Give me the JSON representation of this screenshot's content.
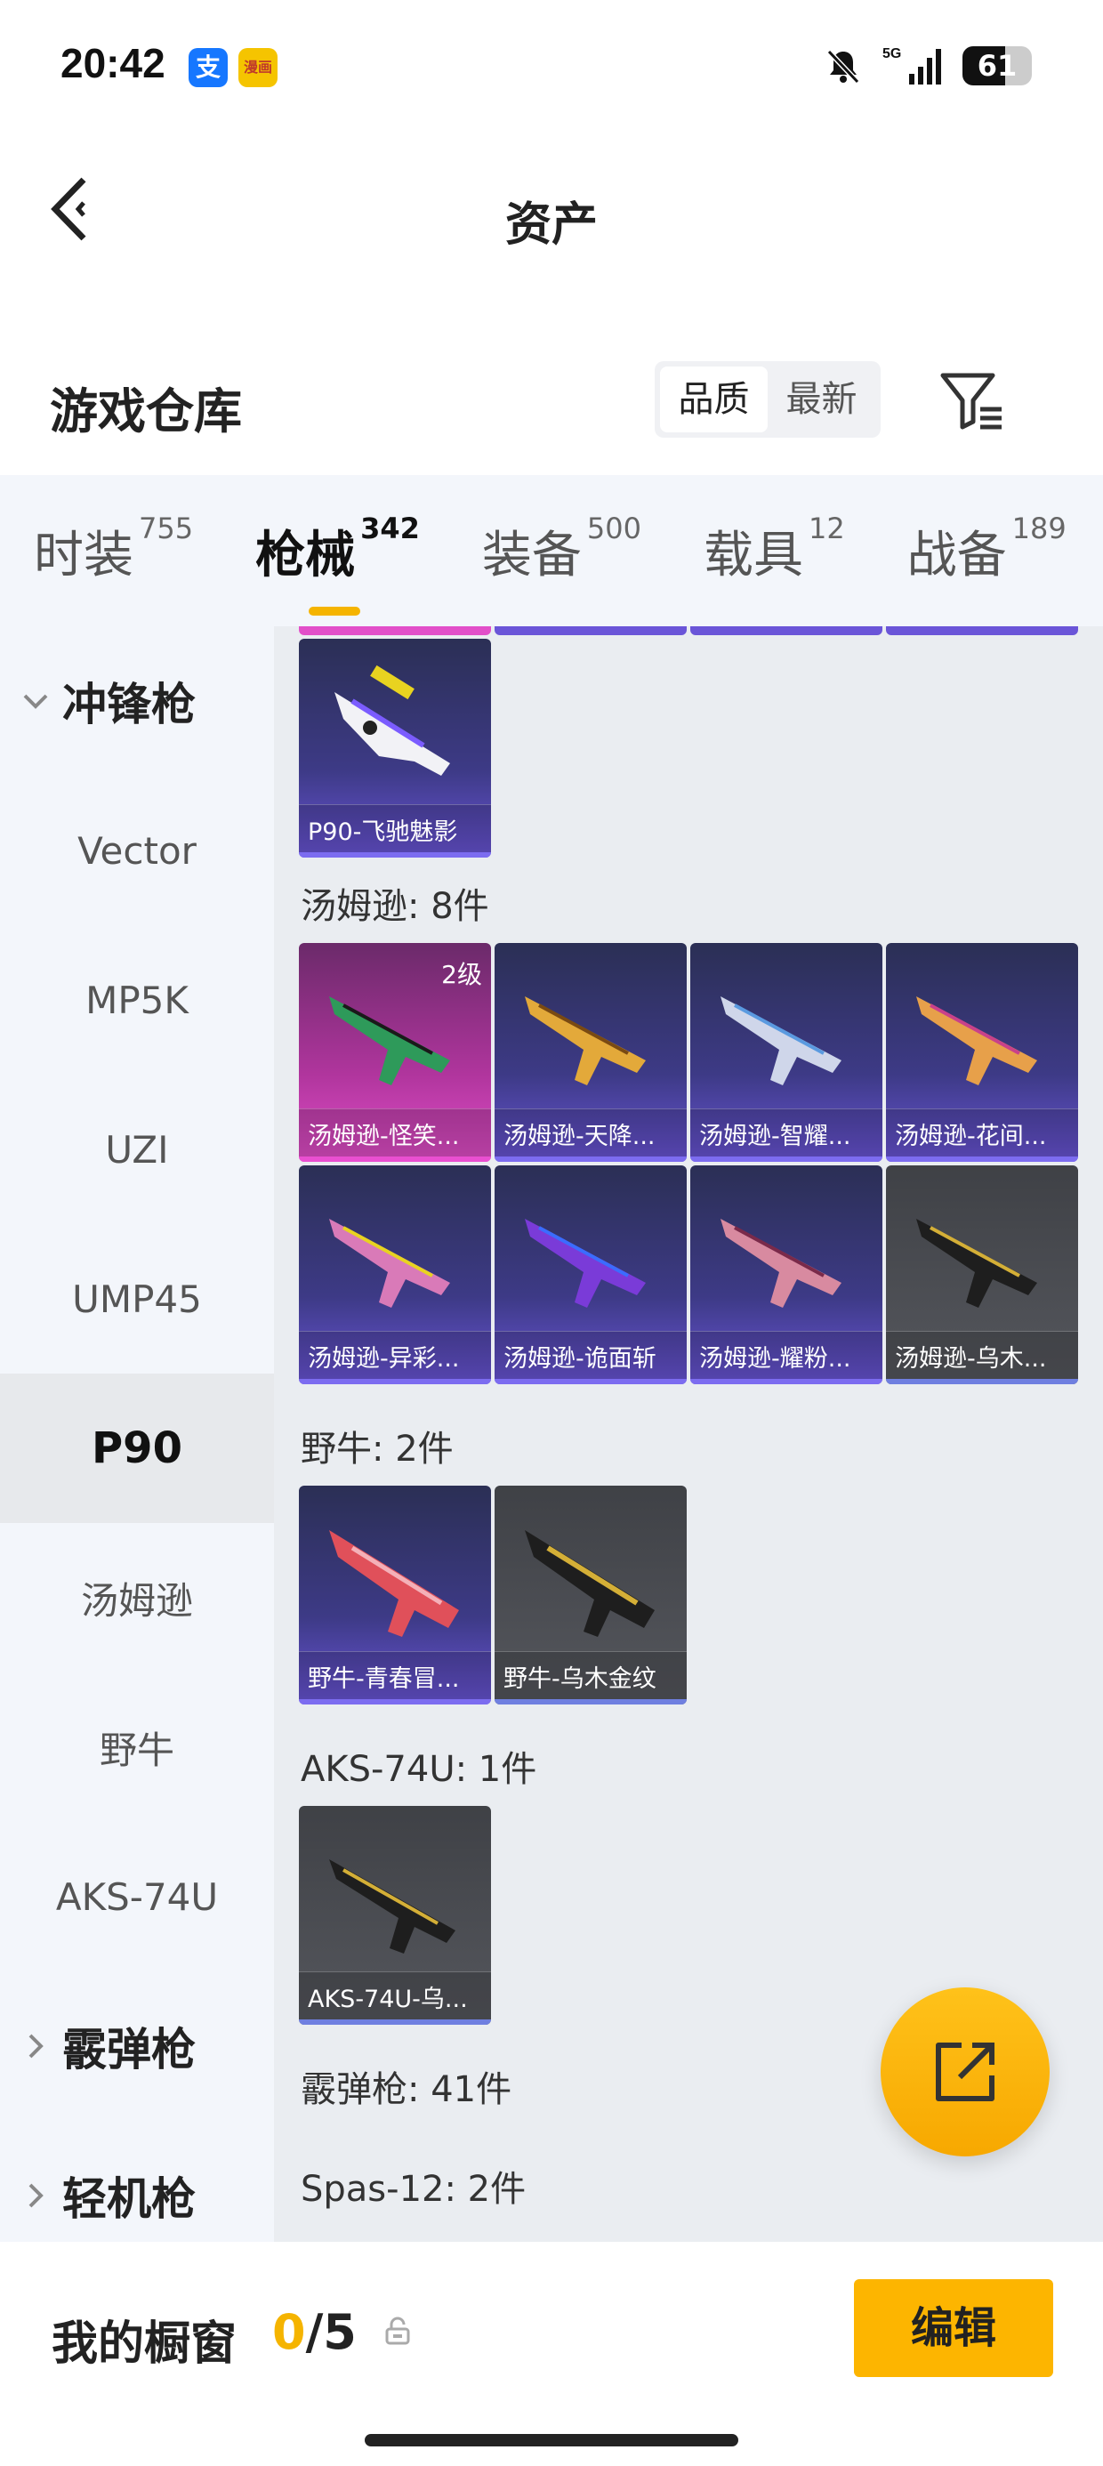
{
  "status_bar": {
    "time": "20:42",
    "battery": "61",
    "alipay_badge": "支",
    "game_badge": "漫画"
  },
  "header": {
    "title": "资产"
  },
  "warehouse": {
    "title": "游戏仓库",
    "sort_options": [
      "品质",
      "最新"
    ]
  },
  "category_tabs": [
    {
      "label": "时装",
      "count": "755"
    },
    {
      "label": "枪械",
      "count": "342"
    },
    {
      "label": "装备",
      "count": "500"
    },
    {
      "label": "载具",
      "count": "12"
    },
    {
      "label": "战备",
      "count": "189"
    }
  ],
  "sidebar": {
    "items": [
      "冲锋枪",
      "Vector",
      "MP5K",
      "UZI",
      "UMP45",
      "P90",
      "汤姆逊",
      "野牛",
      "AKS-74U",
      "霰弹枪",
      "轻机枪"
    ]
  },
  "content": {
    "p90_cards": [
      "P90-飞驰魅影"
    ],
    "thompson_header": "汤姆逊: 8件",
    "thompson_cards": [
      "汤姆逊-怪笑...",
      "汤姆逊-天降...",
      "汤姆逊-智耀...",
      "汤姆逊-花间...",
      "汤姆逊-异彩...",
      "汤姆逊-诡面斩",
      "汤姆逊-耀粉...",
      "汤姆逊-乌木..."
    ],
    "thompson_level": "2级",
    "bison_header": "野牛: 2件",
    "bison_cards": [
      "野牛-青春冒...",
      "野牛-乌木金纹"
    ],
    "aks_header": "AKS-74U: 1件",
    "aks_cards": [
      "AKS-74U-乌..."
    ],
    "shotgun_header": "霰弹枪: 41件",
    "spas_header": "Spas-12: 2件"
  },
  "bottom": {
    "showcase_title": "我的橱窗",
    "showcase_used": "0",
    "showcase_total": "/5",
    "edit_label": "编辑"
  },
  "colors": {
    "accent": "#f5b400",
    "purple_card": "#3d3a86",
    "pink_card": "#b0359d",
    "gray_card": "#55575d"
  }
}
